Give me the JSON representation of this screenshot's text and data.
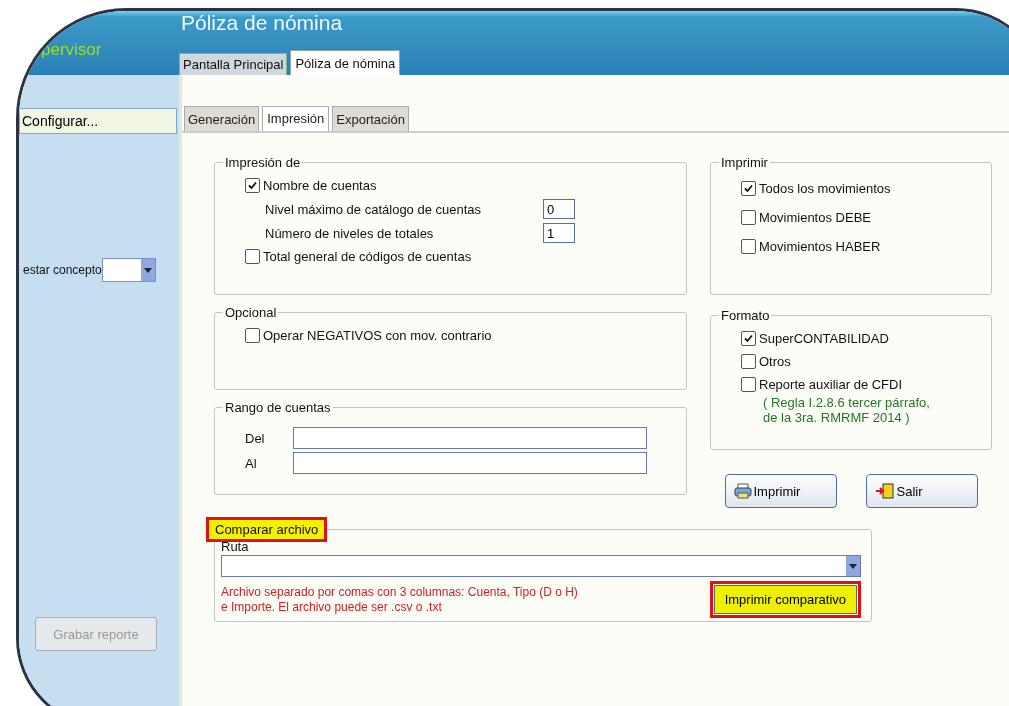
{
  "header": {
    "user_label": "pervisor",
    "title": "Póliza de nómina"
  },
  "main_tabs": [
    {
      "label": "Pantalla Principal",
      "selected": false
    },
    {
      "label": "Póliza de nómina",
      "selected": true
    }
  ],
  "sidebar": {
    "configure_button": "Configurar...",
    "concept_label": "estar concepto",
    "save_button": {
      "label": "Grabar reporte",
      "disabled": true
    }
  },
  "sub_tabs": [
    {
      "label": "Generación",
      "selected": false
    },
    {
      "label": "Impresión",
      "selected": true
    },
    {
      "label": "Exportación",
      "selected": false
    }
  ],
  "print_of": {
    "legend": "Impresión de",
    "account_names": {
      "label": "Nombre de cuentas",
      "checked": true
    },
    "max_level": {
      "label": "Nivel máximo de catálogo de cuentas",
      "value": "0"
    },
    "total_levels": {
      "label": "Número de niveles de totales",
      "value": "1"
    },
    "grand_total": {
      "label": "Total general de códigos de cuentas",
      "checked": false
    }
  },
  "optional": {
    "legend": "Opcional",
    "options": [
      {
        "label": "Operar NEGATIVOS con mov. contrario",
        "checked": false
      }
    ]
  },
  "account_range": {
    "legend": "Rango de cuentas",
    "fields": [
      {
        "label": "Del"
      },
      {
        "label": "Al"
      }
    ]
  },
  "print": {
    "legend": "Imprimir",
    "options": [
      {
        "label": "Todos los movimientos",
        "checked": true
      },
      {
        "label": "Movimientos DEBE",
        "checked": false
      },
      {
        "label": "Movimientos HABER",
        "checked": false
      }
    ]
  },
  "format": {
    "legend": "Formato",
    "options": [
      {
        "label": "SuperCONTABILIDAD",
        "checked": true
      },
      {
        "label": "Otros",
        "checked": false
      },
      {
        "label": "Reporte auxiliar de CFDI",
        "checked": false
      }
    ],
    "note": "( Regla I.2.8.6 tercer párrafo,\nde la 3ra. RMRMF 2014 )"
  },
  "buttons": [
    {
      "label": "Imprimir",
      "kind": "printer"
    },
    {
      "label": "Salir",
      "kind": "exit"
    }
  ],
  "compare": {
    "legend": "Comparar archivo",
    "highlighted": true,
    "path_label": "Ruta",
    "note": "Archivo separado por comas con 3 columnas: Cuenta, Tipo (D o H)\ne Importe. El archivo puede ser .csv o .txt",
    "button": {
      "label": "Imprimir comparativo",
      "highlighted": true
    }
  }
}
